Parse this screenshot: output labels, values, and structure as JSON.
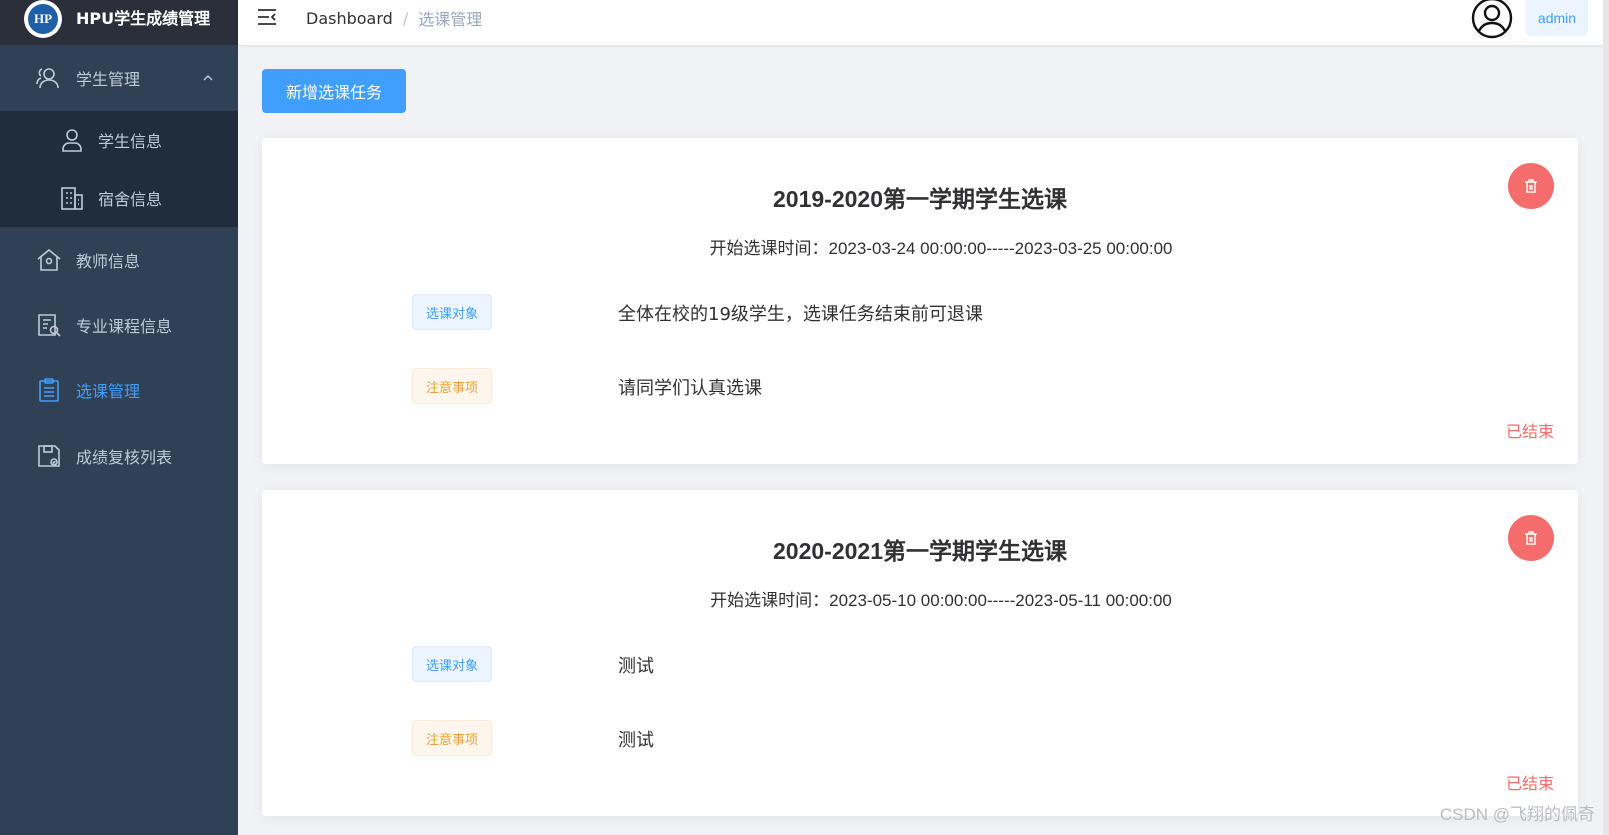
{
  "app": {
    "title": "HPU学生成绩管理",
    "logo_text": "HP"
  },
  "sidebar": {
    "items": [
      {
        "label": "学生管理",
        "icon": "users-icon"
      },
      {
        "label": "学生信息",
        "icon": "user-icon"
      },
      {
        "label": "宿舍信息",
        "icon": "building-icon"
      },
      {
        "label": "教师信息",
        "icon": "home-icon"
      },
      {
        "label": "专业课程信息",
        "icon": "document-icon"
      },
      {
        "label": "选课管理",
        "icon": "clipboard-icon",
        "active": true
      },
      {
        "label": "成绩复核列表",
        "icon": "save-icon"
      }
    ]
  },
  "header": {
    "breadcrumb": {
      "root": "Dashboard",
      "separator": "/",
      "current": "选课管理"
    },
    "user": "admin"
  },
  "main": {
    "add_button": "新增选课任务",
    "cards": [
      {
        "title": "2019-2020第一学期学生选课",
        "time": "开始选课时间：2023-03-24 00:00:00-----2023-03-25 00:00:00",
        "target_tag": "选课对象",
        "target_text": "全体在校的19级学生，选课任务结束前可退课",
        "notes_tag": "注意事项",
        "notes_text": "请同学们认真选课",
        "status": "已结束"
      },
      {
        "title": "2020-2021第一学期学生选课",
        "time": "开始选课时间：2023-05-10 00:00:00-----2023-05-11 00:00:00",
        "target_tag": "选课对象",
        "target_text": "测试",
        "notes_tag": "注意事项",
        "notes_text": "测试",
        "status": "已结束"
      }
    ]
  },
  "watermark": "CSDN @飞翔的佩奇",
  "colors": {
    "sidebar_bg": "#304156",
    "accent": "#409eff",
    "danger": "#f56c6c",
    "warning": "#e6a23c"
  }
}
